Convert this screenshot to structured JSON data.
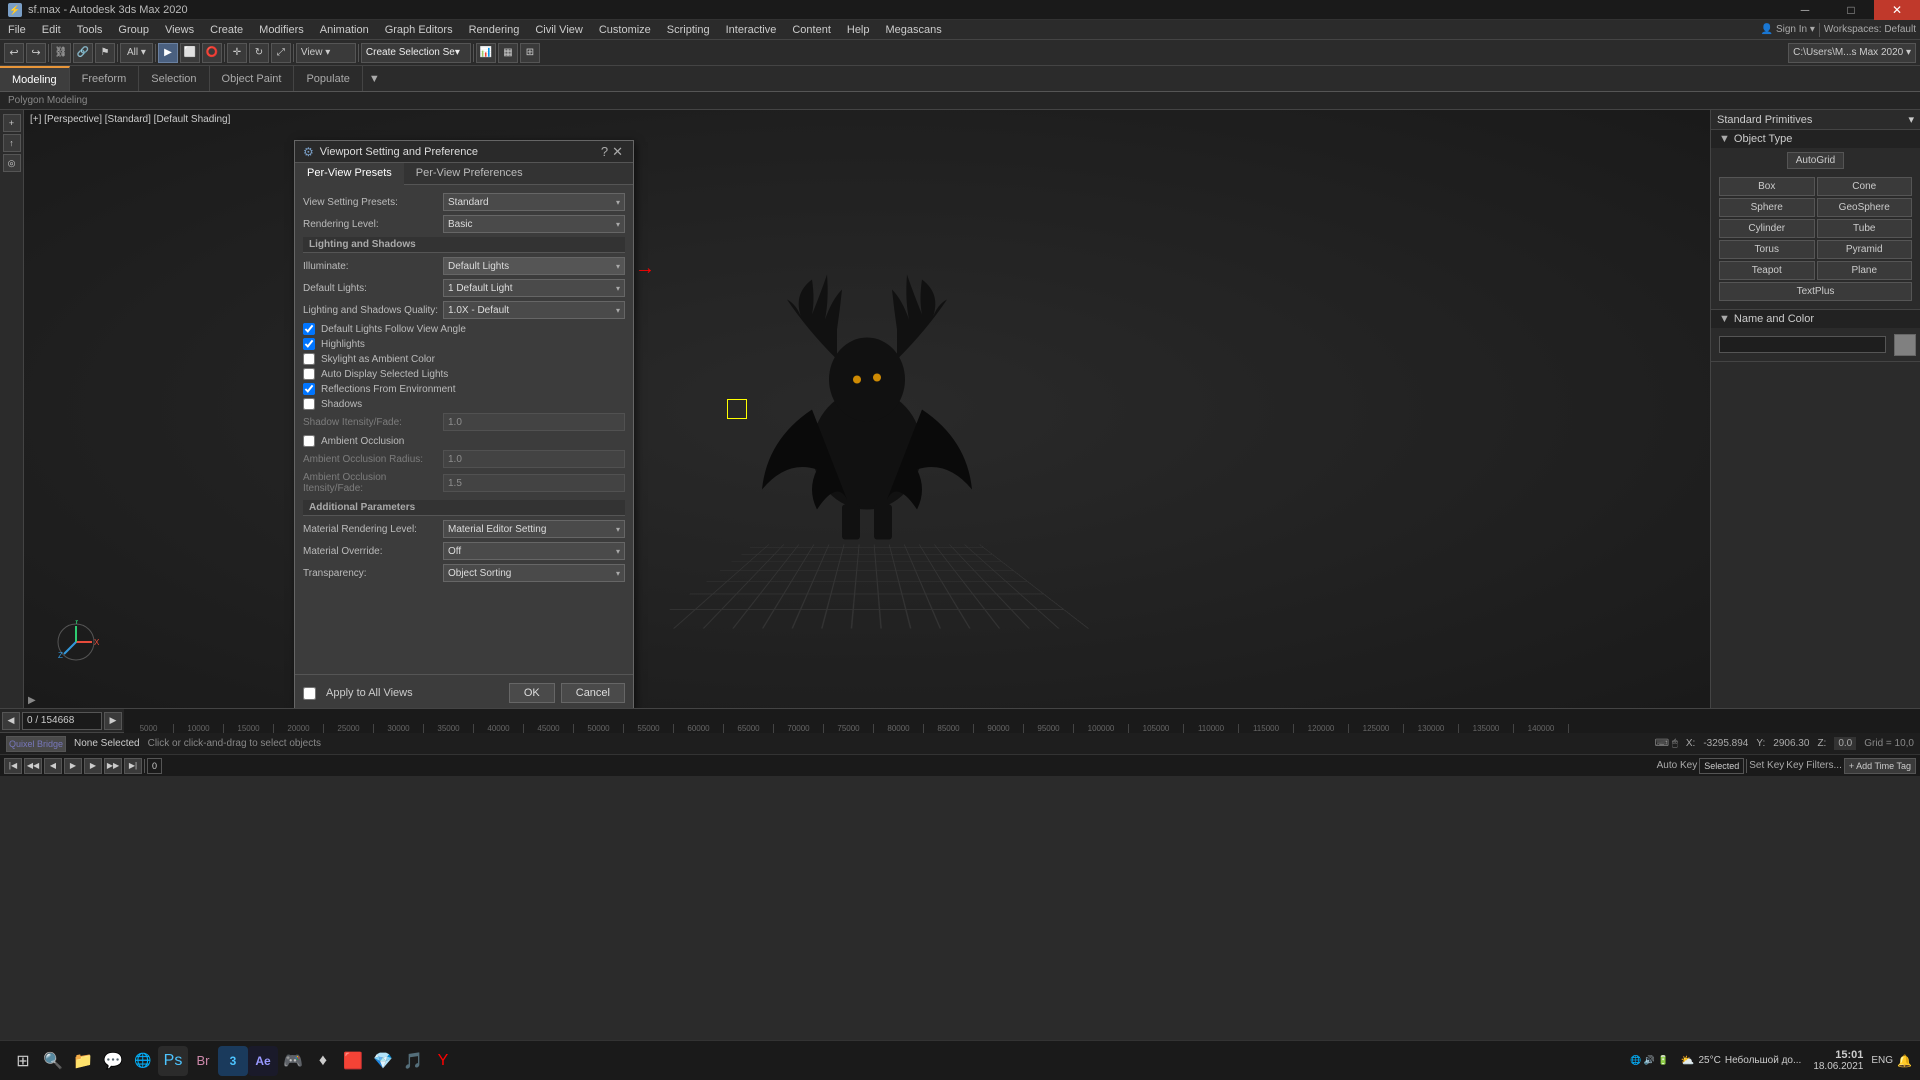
{
  "app": {
    "title": "sf.max - Autodesk 3ds Max 2020",
    "window_controls": [
      "minimize",
      "maximize",
      "close"
    ]
  },
  "menubar": {
    "items": [
      "File",
      "Edit",
      "Tools",
      "Group",
      "Views",
      "Create",
      "Modifiers",
      "Animation",
      "Graph Editors",
      "Rendering",
      "Civil View",
      "Customize",
      "Scripting",
      "Interactive",
      "Content",
      "Help",
      "Megascans"
    ]
  },
  "toolbar1": {
    "items": [
      "undo",
      "redo",
      "link",
      "unlink",
      "bind",
      "select",
      "select-region",
      "move",
      "rotate",
      "scale",
      "mirror",
      "align",
      "snap"
    ],
    "mode_label": "All",
    "view_label": "View"
  },
  "toolbar2": {
    "tabs": [
      "Modeling",
      "Freeform",
      "Selection",
      "Object Paint",
      "Populate"
    ],
    "active_tab": "Modeling",
    "breadcrumb": "Polygon Modeling"
  },
  "nav_tabs": {
    "create_selection_label": "Create Selection Se",
    "other_label": ""
  },
  "viewport": {
    "label": "[+] [Perspective] [Standard] [Default Shading]"
  },
  "dialog": {
    "title": "Viewport Setting and Preference",
    "icon": "⚙",
    "tabs": [
      {
        "id": "per-view-presets",
        "label": "Per-View Presets",
        "active": true
      },
      {
        "id": "per-view-preferences",
        "label": "Per-View Preferences",
        "active": false
      }
    ],
    "view_setting_presets_label": "View Setting Presets:",
    "view_setting_presets_value": "Standard",
    "rendering_level_label": "Rendering Level:",
    "rendering_level_value": "Basic",
    "lighting_shadows_header": "Lighting and Shadows",
    "illuminate_label": "Illuminate:",
    "illuminate_value": "Default Lights",
    "default_lights_label": "Default Lights:",
    "default_lights_value": "1 Default Light",
    "lighting_quality_label": "Lighting and Shadows Quality:",
    "lighting_quality_value": "1.0X - Default",
    "checkboxes": [
      {
        "id": "default-lights-follow",
        "label": "Default Lights Follow View Angle",
        "checked": true
      },
      {
        "id": "highlights",
        "label": "Highlights",
        "checked": true
      },
      {
        "id": "skylight",
        "label": "Skylight as Ambient Color",
        "checked": false
      },
      {
        "id": "auto-display",
        "label": "Auto Display Selected Lights",
        "checked": false
      },
      {
        "id": "reflections",
        "label": "Reflections From Environment",
        "checked": true
      },
      {
        "id": "shadows",
        "label": "Shadows",
        "checked": false
      }
    ],
    "shadow_intensity_label": "Shadow Itensity/Fade:",
    "shadow_intensity_value": "1.0",
    "ambient_occlusion_label": "Ambient Occlusion",
    "ambient_occlusion_checked": false,
    "ao_radius_label": "Ambient Occlusion Radius:",
    "ao_radius_value": "1.0",
    "ao_intensity_label": "Ambient Occlusion Itensity/Fade:",
    "ao_intensity_value": "1.5",
    "additional_params_header": "Additional Parameters",
    "material_rendering_level_label": "Material Rendering Level:",
    "material_rendering_level_value": "Material Editor Setting",
    "material_override_label": "Material Override:",
    "material_override_value": "Off",
    "transparency_label": "Transparency:",
    "transparency_value": "Object Sorting",
    "apply_to_all_views_label": "Apply to All Views",
    "ok_label": "OK",
    "cancel_label": "Cancel"
  },
  "right_panel": {
    "dropdown_label": "Standard Primitives",
    "sections": [
      {
        "id": "object-type",
        "label": "Object Type",
        "collapsed": false,
        "items_grid": [
          "Box",
          "Cone",
          "Sphere",
          "GeoSphere",
          "Cylinder",
          "Tube",
          "Torus",
          "Pyramid",
          "Teapot",
          "Plane",
          "TextPlus"
        ]
      },
      {
        "id": "name-and-color",
        "label": "Name and Color",
        "collapsed": false
      }
    ]
  },
  "timeline": {
    "frame_range": "0 / 154668",
    "ticks": [
      "5000",
      "10000",
      "15000",
      "20000",
      "25000",
      "30000",
      "35000",
      "40000",
      "45000",
      "50000",
      "55000",
      "60000",
      "65000",
      "70000",
      "75000",
      "80000",
      "85000",
      "90000",
      "95000",
      "100000",
      "105000",
      "110000",
      "115000",
      "120000",
      "125000",
      "130000",
      "135000",
      "140000"
    ]
  },
  "statusbar": {
    "selection_label": "None Selected",
    "hint_label": "Click or click-and-drag to select objects",
    "x_label": "X:",
    "x_value": "-3295.894",
    "y_label": "Y:",
    "y_value": "2906.30",
    "z_label": "Z:",
    "z_value": "0.0",
    "grid_label": "Grid =",
    "grid_value": "10.0",
    "frame_label": "0",
    "selected_label": "Selected"
  },
  "taskbar": {
    "start_label": "⊞",
    "search_label": "🔍",
    "system_tray": {
      "temp": "25°C",
      "weather": "Небольшой до...",
      "time": "15:01",
      "date": "18.06.2021",
      "lang": "ENG"
    },
    "apps": [
      "⊞",
      "🔍",
      "📁",
      "💬",
      "🌐",
      "🎨",
      "🖼",
      "🟦",
      "🎮",
      "♦",
      "🟥",
      "💎",
      "🟣",
      "🎵",
      "Y"
    ]
  }
}
